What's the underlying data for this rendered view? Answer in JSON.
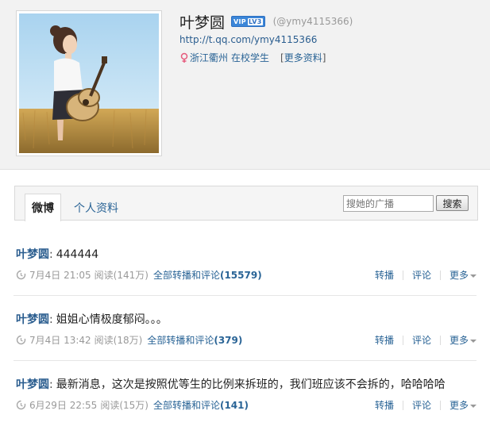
{
  "profile": {
    "name": "叶梦圆",
    "badge": {
      "text": "VIP",
      "level": "LV3"
    },
    "handle": "(@ymy4115366)",
    "homepage_url": "http://t.qq.com/ymy4115366",
    "location": "浙江衢州",
    "status": "在校学生",
    "more_info_label": "更多资料",
    "more_info_open": "[",
    "more_info_close": "]"
  },
  "tabs": {
    "weibo": "微博",
    "profile": "个人资料"
  },
  "search": {
    "placeholder": "搜她的广播",
    "button": "搜索"
  },
  "actions": {
    "repost": "转播",
    "comment": "评论",
    "more": "更多"
  },
  "posts": [
    {
      "author": "叶梦圆",
      "colon": ":",
      "text": "444444",
      "date": "7月4日 21:05",
      "reads": "阅读(141万)",
      "all_label": "全部转播和评论",
      "count": "(15579)"
    },
    {
      "author": "叶梦圆",
      "colon": ":",
      "text": "姐姐心情极度郁闷。。。",
      "date": "7月4日 13:42",
      "reads": "阅读(18万)",
      "all_label": "全部转播和评论",
      "count": "(379)"
    },
    {
      "author": "叶梦圆",
      "colon": ":",
      "text": "最新消息，这次是按照优等生的比例来拆班的，我们班应该不会拆的，哈哈哈哈",
      "date": "6月29日 22:55",
      "reads": "阅读(15万)",
      "all_label": "全部转播和评论",
      "count": "(141)"
    }
  ],
  "colors": {
    "link": "#2a6496",
    "header_bg": "#f2f2f2",
    "badge_blue": "#3b86d8"
  },
  "icons": {
    "gender": "female-icon",
    "clock": "clock-icon",
    "more_caret": "caret-down-icon"
  }
}
